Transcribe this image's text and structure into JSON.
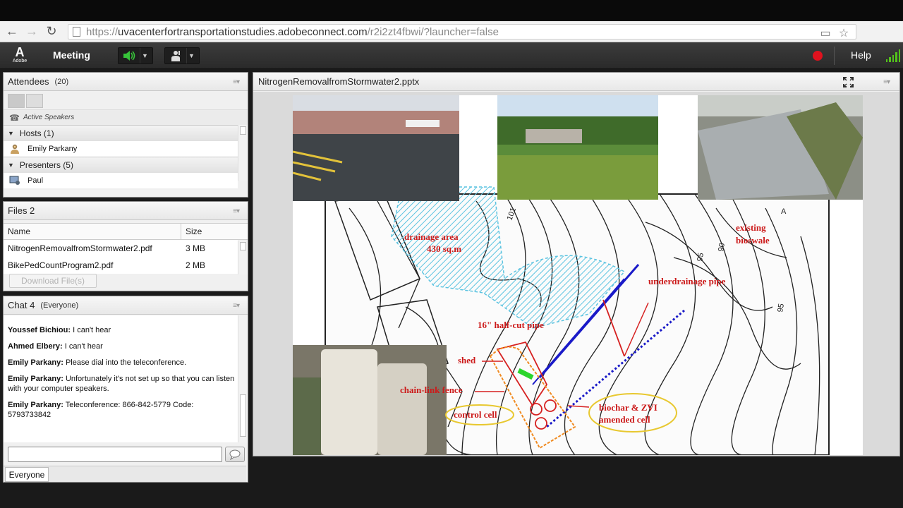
{
  "browser": {
    "url_prefix": "https://",
    "url_host": "uvacenterfortransportationstudies.adobeconnect.com",
    "url_path": "/r2i2zt4fbwi/?launcher=false"
  },
  "toolbar": {
    "logo_text": "Adobe",
    "meeting_label": "Meeting",
    "help_label": "Help",
    "colors": {
      "record": "#e0121e",
      "signal": "#53c21b",
      "speaker": "#37c43a"
    }
  },
  "attendees": {
    "title": "Attendees",
    "count": "(20)",
    "active_speakers": "Active Speakers",
    "hosts_label": "Hosts (1)",
    "hosts": [
      "Emily Parkany"
    ],
    "presenters_label": "Presenters (5)",
    "presenters": [
      "Paul"
    ]
  },
  "files": {
    "title": "Files 2",
    "col_name": "Name",
    "col_size": "Size",
    "rows": [
      {
        "name": "NitrogenRemovalfromStormwater2.pdf",
        "size": "3 MB"
      },
      {
        "name": "BikePedCountProgram2.pdf",
        "size": "2 MB"
      }
    ],
    "download_label": "Download File(s)"
  },
  "chat": {
    "title": "Chat 4",
    "audience": "(Everyone)",
    "messages": [
      {
        "from": "Youssef Bichiou:",
        "text": "I can't hear"
      },
      {
        "from": "Ahmed Elbery:",
        "text": "I can't hear"
      },
      {
        "from": "Emily Parkany:",
        "text": "Please dial into the teleconference."
      },
      {
        "from": "Emily Parkany:",
        "text": "Unfortunately it's not set up so that you can listen with your computer speakers."
      },
      {
        "from": "Emily Parkany:",
        "text": " Teleconference:  866-842-5779  Code: 5793733842"
      }
    ],
    "input_value": "",
    "tab_label": "Everyone"
  },
  "share": {
    "title": "NitrogenRemovalfromStormwater2.pptx",
    "slide_labels": {
      "drainage_area": "drainage area",
      "drainage_area_size": "430 sq.m",
      "existing": "existing",
      "bioswale": "bioswale",
      "underdrainage": "underdrainage pipe",
      "halfcut": "16\" half-cut pipe",
      "shed": "shed",
      "chainlink": "chain-link fence",
      "control": "control cell",
      "biochar": "biochar & ZVI",
      "amended": "amended cell"
    },
    "contour_labels": [
      "101",
      "95",
      "90",
      "95",
      "A"
    ]
  }
}
